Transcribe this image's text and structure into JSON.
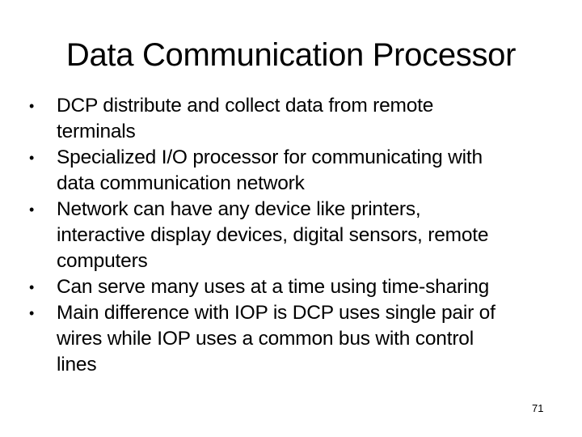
{
  "slide": {
    "title": "Data Communication Processor",
    "bullet_glyph": "•",
    "bullets": [
      {
        "lines": [
          "DCP distribute and collect data from remote",
          "terminals"
        ]
      },
      {
        "lines": [
          "Specialized I/O processor for communicating with",
          "data communication network"
        ]
      },
      {
        "lines": [
          "Network can have any device like printers,",
          "interactive display devices, digital sensors, remote",
          "computers"
        ]
      },
      {
        "lines": [
          "Can serve many uses at a time using time-sharing"
        ]
      },
      {
        "lines": [
          "Main difference with IOP is DCP uses single pair of",
          "wires while IOP uses a common bus with control",
          "lines"
        ]
      }
    ],
    "page_number": "71"
  }
}
